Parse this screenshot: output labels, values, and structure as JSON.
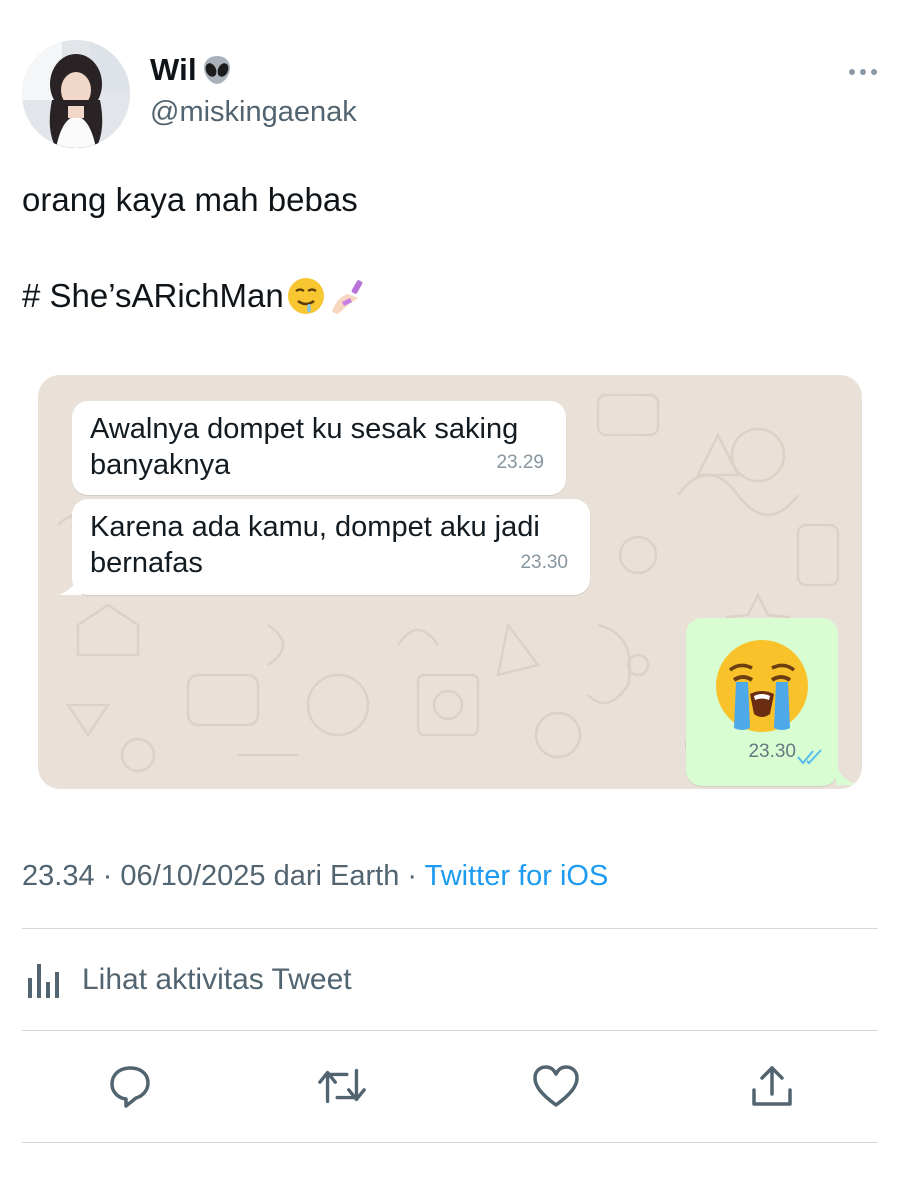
{
  "author": {
    "display_name": "Wil",
    "handle": "@miskingaenak",
    "name_emoji_icon": "alien-emoji-icon"
  },
  "tweet": {
    "text": "orang kaya mah bebas",
    "hashtag_text": "# She’sARichMan",
    "hashtag_emoji_icons": [
      "drooling-face-emoji-icon",
      "nail-polish-emoji-icon"
    ]
  },
  "media": {
    "messages": [
      {
        "text": "Awalnya dompet ku sesak saking banyaknya",
        "time": "23.29",
        "direction": "incoming"
      },
      {
        "text": "Karena ada kamu, dompet aku jadi bernafas",
        "time": "23.30",
        "direction": "incoming"
      },
      {
        "emoji_icon": "loudly-crying-face-emoji-icon",
        "time": "23.30",
        "direction": "outgoing",
        "status_icon": "double-check-icon"
      }
    ],
    "background_color": "#e9e1d8",
    "outgoing_bubble_color": "#d9fdd3"
  },
  "meta": {
    "time": "23.34",
    "date": "06/10/2025",
    "location_text": "dari Earth",
    "separator": "·",
    "source": "Twitter for iOS"
  },
  "activity": {
    "label": "Lihat aktivitas Tweet",
    "icon": "bar-chart-icon"
  },
  "actions": [
    {
      "name": "reply",
      "icon": "reply-icon"
    },
    {
      "name": "retweet",
      "icon": "retweet-icon"
    },
    {
      "name": "like",
      "icon": "heart-icon"
    },
    {
      "name": "share",
      "icon": "share-icon"
    }
  ],
  "colors": {
    "text": "#0f1419",
    "secondary": "#536471",
    "link": "#1d9bf0",
    "divider": "#cfd9de"
  }
}
